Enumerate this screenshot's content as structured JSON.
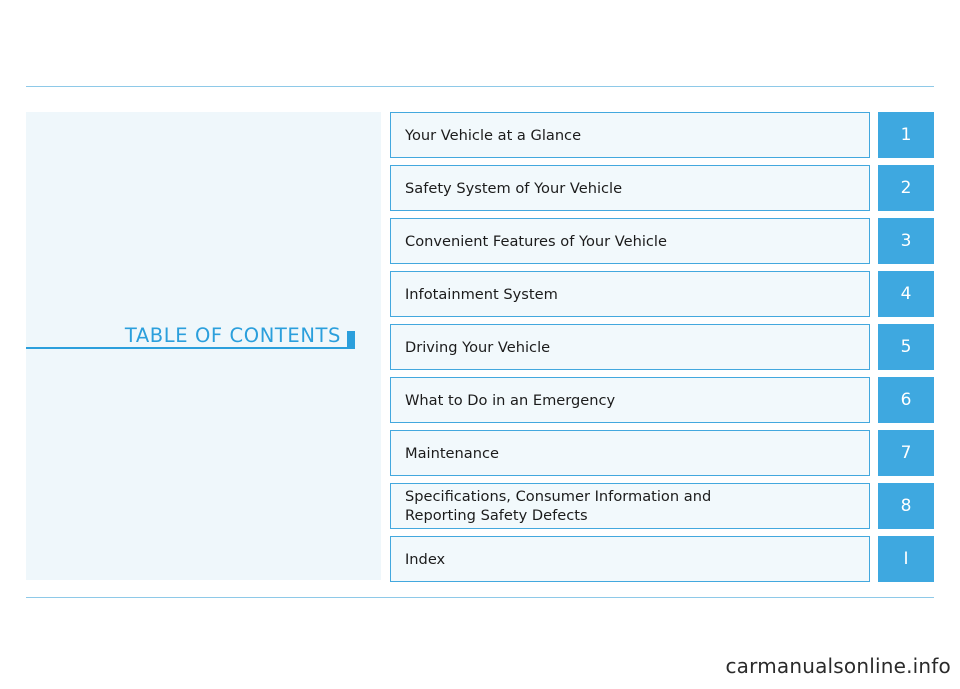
{
  "document": {
    "toc_heading": "TABLE OF CONTENTS",
    "watermark": "carmanualsonline.info",
    "accent_color": "#3ea8e0",
    "panel_color": "#eff7fb",
    "entries": [
      {
        "title": "Your Vehicle at a Glance",
        "title_line2": "",
        "number": "1"
      },
      {
        "title": "Safety System of Your Vehicle",
        "title_line2": "",
        "number": "2"
      },
      {
        "title": "Convenient Features of Your Vehicle",
        "title_line2": "",
        "number": "3"
      },
      {
        "title": "Infotainment System",
        "title_line2": "",
        "number": "4"
      },
      {
        "title": "Driving Your Vehicle",
        "title_line2": "",
        "number": "5"
      },
      {
        "title": "What to Do in an Emergency",
        "title_line2": "",
        "number": "6"
      },
      {
        "title": "Maintenance",
        "title_line2": "",
        "number": "7"
      },
      {
        "title": "Specifications, Consumer Information and",
        "title_line2": "Reporting Safety Defects",
        "number": "8"
      },
      {
        "title": "Index",
        "title_line2": "",
        "number": "I"
      }
    ]
  }
}
